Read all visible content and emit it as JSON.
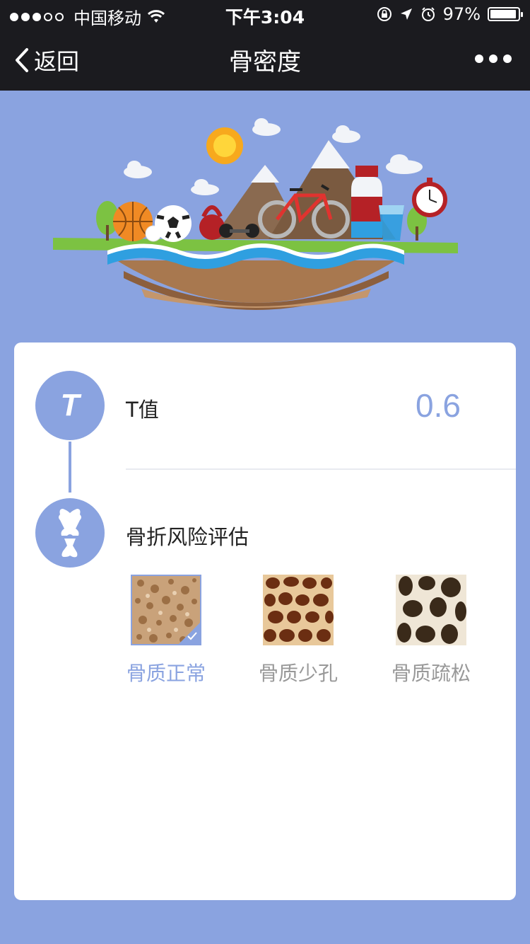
{
  "status_bar": {
    "carrier": "中国移动",
    "time": "下午3:04",
    "battery": "97%"
  },
  "nav": {
    "back_label": "返回",
    "title": "骨密度"
  },
  "result": {
    "t_badge": "T",
    "t_label": "T值",
    "t_value": "0.6"
  },
  "risk": {
    "title": "骨折风险评估",
    "options": [
      {
        "label": "骨质正常",
        "selected": true
      },
      {
        "label": "骨质少孔",
        "selected": false
      },
      {
        "label": "骨质疏松",
        "selected": false
      }
    ]
  },
  "colors": {
    "accent": "#8aa3e0",
    "bar": "#1b1b1f"
  }
}
